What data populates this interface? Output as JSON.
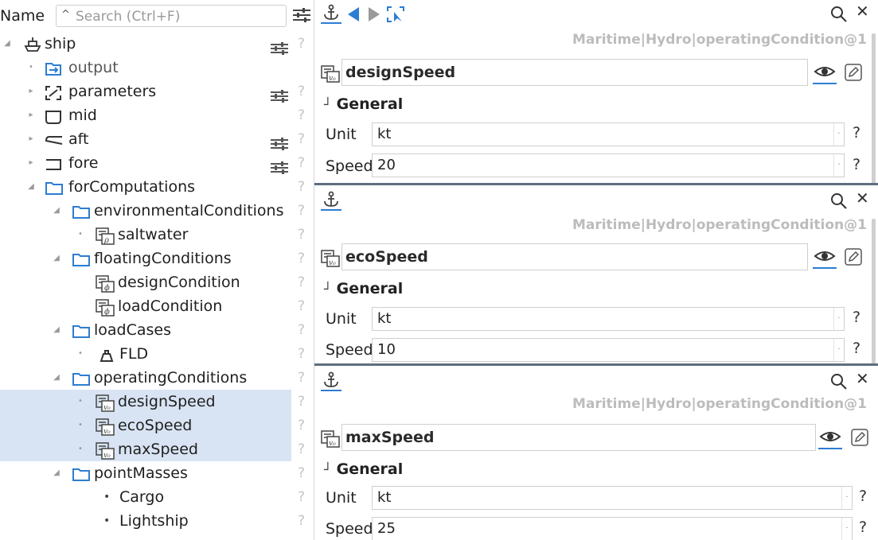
{
  "tree": {
    "name_label": "Name",
    "search_placeholder": "Search (Ctrl+F)",
    "nodes": [
      {
        "label": "ship"
      },
      {
        "label": "output"
      },
      {
        "label": "parameters"
      },
      {
        "label": "mid"
      },
      {
        "label": "aft"
      },
      {
        "label": "fore"
      },
      {
        "label": "forComputations"
      },
      {
        "label": "environmentalConditions"
      },
      {
        "label": "saltwater"
      },
      {
        "label": "floatingConditions"
      },
      {
        "label": "designCondition"
      },
      {
        "label": "loadCondition"
      },
      {
        "label": "loadCases"
      },
      {
        "label": "FLD"
      },
      {
        "label": "operatingConditions"
      },
      {
        "label": "designSpeed"
      },
      {
        "label": "ecoSpeed"
      },
      {
        "label": "maxSpeed"
      },
      {
        "label": "pointMasses"
      },
      {
        "label": "Cargo"
      },
      {
        "label": "Lightship"
      }
    ],
    "help_mark": "?"
  },
  "panels": [
    {
      "breadcrumb": "Maritime|Hydro|operatingCondition@1",
      "object_name": "designSpeed",
      "section": "General",
      "unit_label": "Unit",
      "unit_value": "kt",
      "speed_label": "Speed",
      "speed_value": "20",
      "help": "?"
    },
    {
      "breadcrumb": "Maritime|Hydro|operatingCondition@1",
      "object_name": "ecoSpeed",
      "section": "General",
      "unit_label": "Unit",
      "unit_value": "kt",
      "speed_label": "Speed",
      "speed_value": "10",
      "help": "?"
    },
    {
      "breadcrumb": "Maritime|Hydro|operatingCondition@1",
      "object_name": "maxSpeed",
      "section": "General",
      "unit_label": "Unit",
      "unit_value": "kt",
      "speed_label": "Speed",
      "speed_value": "25",
      "help": "?"
    }
  ],
  "colors": {
    "accent": "#2d7dd2",
    "selection": "#d8e4f3",
    "breadcrumb": "#bcbcbc",
    "separator": "#5e6e7e"
  },
  "icons": {
    "anchor": "anchor-icon",
    "back": "back-arrow-icon",
    "forward": "forward-arrow-icon",
    "select": "select-icon",
    "find": "search-icon",
    "close": "close-icon",
    "eye": "eye-icon",
    "edit": "edit-icon",
    "filter": "filter-sliders-icon"
  }
}
